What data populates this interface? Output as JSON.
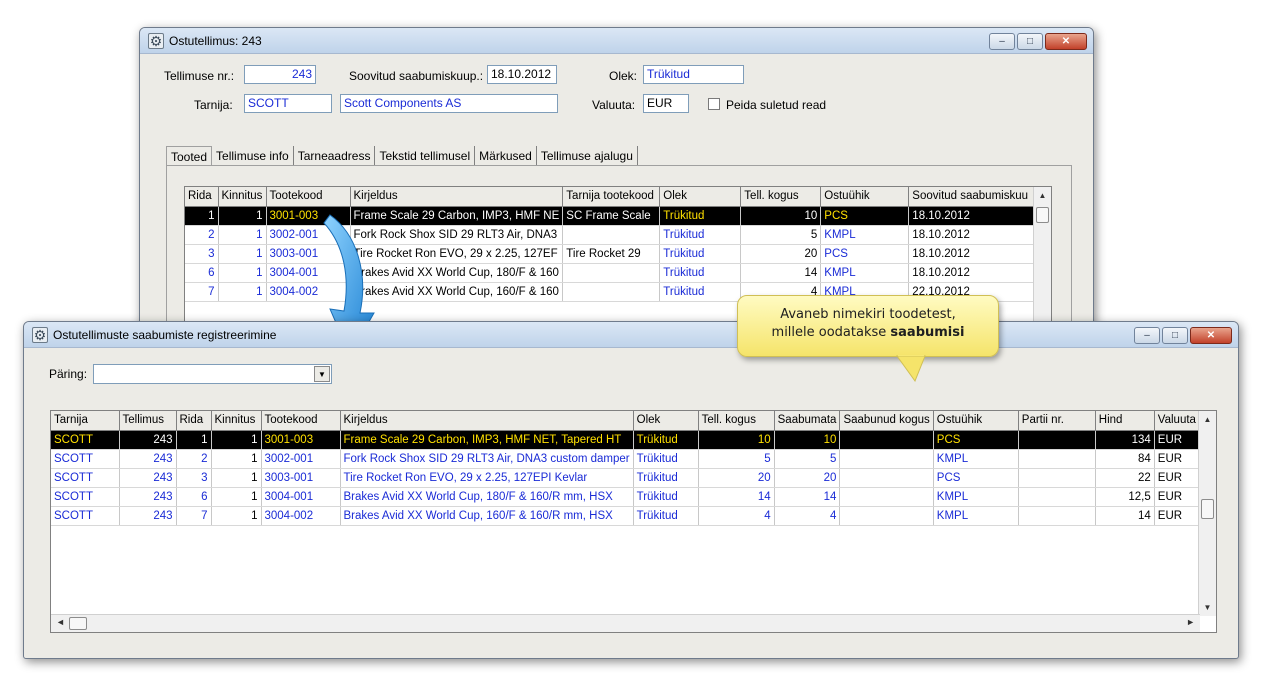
{
  "win1": {
    "title": "Ostutellimus: 243",
    "order_no_label": "Tellimuse nr.:",
    "order_no": "243",
    "arrival_label": "Soovitud saabumiskuup.:",
    "arrival_date": "18.10.2012",
    "status_label": "Olek:",
    "status": "Trükitud",
    "supplier_label": "Tarnija:",
    "supplier_code": "SCOTT",
    "supplier_name": "Scott Components AS",
    "currency_label": "Valuuta:",
    "currency": "EUR",
    "hide_closed_label": "Peida suletud read",
    "tabs": [
      "Tooted",
      "Tellimuse info",
      "Tarneaadress",
      "Tekstid tellimusel",
      "Märkused",
      "Tellimuse ajalugu"
    ],
    "grid": {
      "headers": [
        "Rida",
        "Kinnitus",
        "Tootekood",
        "Kirjeldus",
        "Tarnija tootekood",
        "Olek",
        "Tell. kogus",
        "Ostuühik",
        "Soovitud saabumiskuu"
      ],
      "rows": [
        [
          "1",
          "1",
          "3001-003",
          "Frame Scale 29 Carbon, IMP3, HMF NE",
          "SC Frame Scale",
          "Trükitud",
          "10",
          "PCS",
          "18.10.2012"
        ],
        [
          "2",
          "1",
          "3002-001",
          "Fork Rock Shox SID 29 RLT3 Air, DNA3",
          "",
          "Trükitud",
          "5",
          "KMPL",
          "18.10.2012"
        ],
        [
          "3",
          "1",
          "3003-001",
          "Tire Rocket Ron EVO, 29 x 2.25, 127EF",
          "Tire Rocket 29",
          "Trükitud",
          "20",
          "PCS",
          "18.10.2012"
        ],
        [
          "6",
          "1",
          "3004-001",
          "Brakes Avid XX World Cup, 180/F & 160",
          "",
          "Trükitud",
          "14",
          "KMPL",
          "18.10.2012"
        ],
        [
          "7",
          "1",
          "3004-002",
          "Brakes Avid XX World Cup, 160/F & 160",
          "",
          "Trükitud",
          "4",
          "KMPL",
          "22.10.2012"
        ]
      ]
    }
  },
  "win2": {
    "title": "Ostutellimuste saabumiste registreerimine",
    "query_label": "Päring:",
    "query_value": "",
    "grid": {
      "headers": [
        "Tarnija",
        "Tellimus",
        "Rida",
        "Kinnitus",
        "Tootekood",
        "Kirjeldus",
        "Olek",
        "Tell. kogus",
        "Saabumata",
        "Saabunud kogus",
        "Ostuühik",
        "Partii nr.",
        "Hind",
        "Valuuta"
      ],
      "rows": [
        [
          "SCOTT",
          "243",
          "1",
          "1",
          "3001-003",
          "Frame Scale 29 Carbon, IMP3, HMF NET, Tapered HT",
          "Trükitud",
          "10",
          "10",
          "",
          "PCS",
          "",
          "134",
          "EUR"
        ],
        [
          "SCOTT",
          "243",
          "2",
          "1",
          "3002-001",
          "Fork Rock Shox SID 29 RLT3 Air, DNA3 custom damper",
          "Trükitud",
          "5",
          "5",
          "",
          "KMPL",
          "",
          "84",
          "EUR"
        ],
        [
          "SCOTT",
          "243",
          "3",
          "1",
          "3003-001",
          "Tire Rocket Ron EVO, 29 x 2.25, 127EPI Kevlar",
          "Trükitud",
          "20",
          "20",
          "",
          "PCS",
          "",
          "22",
          "EUR"
        ],
        [
          "SCOTT",
          "243",
          "6",
          "1",
          "3004-001",
          "Brakes Avid XX World Cup, 180/F & 160/R mm, HSX",
          "Trükitud",
          "14",
          "14",
          "",
          "KMPL",
          "",
          "12,5",
          "EUR"
        ],
        [
          "SCOTT",
          "243",
          "7",
          "1",
          "3004-002",
          "Brakes Avid XX World Cup, 160/F & 160/R mm, HSX",
          "Trükitud",
          "4",
          "4",
          "",
          "KMPL",
          "",
          "14",
          "EUR"
        ]
      ]
    }
  },
  "callout": {
    "line1": "Avaneb nimekiri toodetest,",
    "line2_prefix": "millele oodatakse ",
    "line2_bold": "saabumisi"
  },
  "window_buttons": {
    "minimize": "–",
    "maximize": "□",
    "close": "✕"
  },
  "colors": {
    "accent_blue": "#1a2bd6",
    "selection_bg": "#000000",
    "selection_text": "#ffe000",
    "callout_bg": "#fff59a",
    "arrow": "#2e9be0"
  }
}
